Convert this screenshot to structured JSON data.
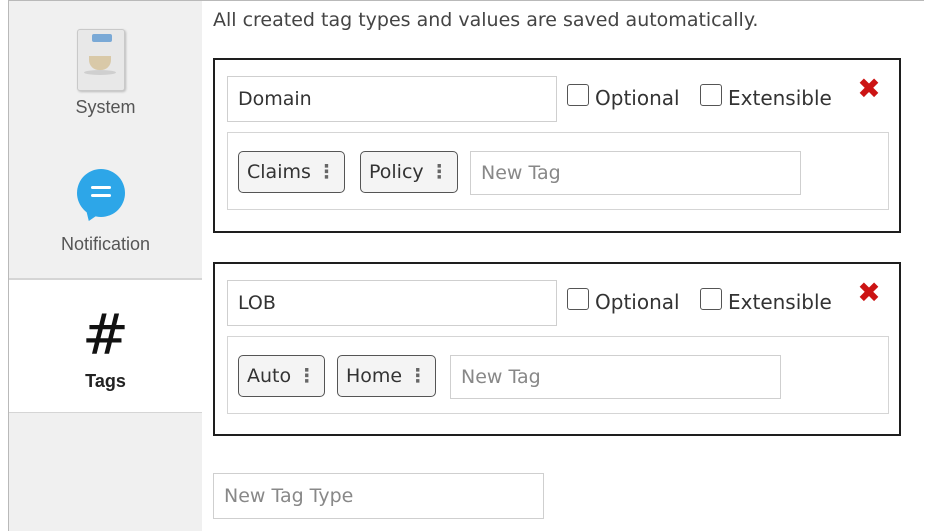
{
  "sidebar": {
    "items": [
      {
        "label": "System",
        "icon": "system-app-icon"
      },
      {
        "label": "Notification",
        "icon": "chat-bubble-icon"
      },
      {
        "label": "Tags",
        "icon": "hash-icon",
        "selected": true
      }
    ]
  },
  "main": {
    "info": "All created tag types and values are saved automatically.",
    "tag_types": [
      {
        "name": "Domain",
        "optional_label": "Optional",
        "extensible_label": "Extensible",
        "optional_checked": false,
        "extensible_checked": false,
        "tags": [
          {
            "label": "Claims",
            "menu": "⋮"
          },
          {
            "label": "Policy",
            "menu": "⋮"
          }
        ],
        "new_tag_placeholder": "New Tag",
        "remove_symbol": "✖"
      },
      {
        "name": "LOB",
        "optional_label": "Optional",
        "extensible_label": "Extensible",
        "optional_checked": false,
        "extensible_checked": false,
        "tags": [
          {
            "label": "Auto",
            "menu": "⋮"
          },
          {
            "label": "Home",
            "menu": "⋮"
          }
        ],
        "new_tag_placeholder": "New Tag",
        "remove_symbol": "✖"
      }
    ],
    "new_tag_type_placeholder": "New Tag Type"
  },
  "colors": {
    "sidebar_bg": "#f0f0f0",
    "accent_blue": "#2da6e8",
    "remove_red": "#cc1414",
    "group_border": "#1e1e1e"
  }
}
